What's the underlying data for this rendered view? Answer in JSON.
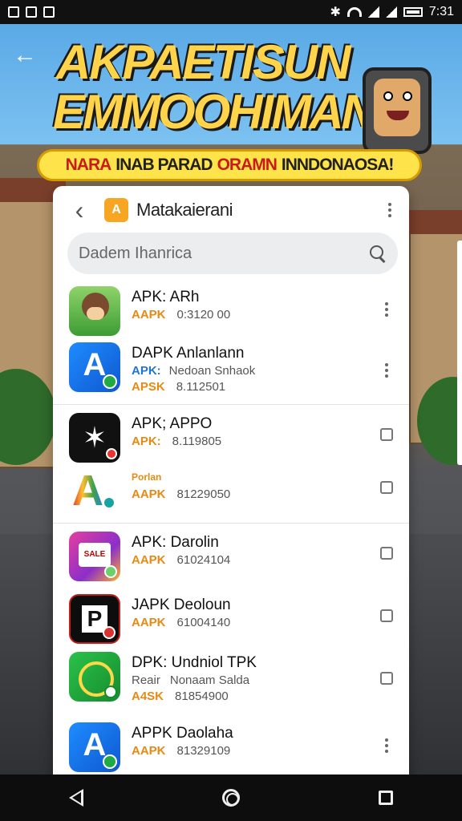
{
  "status_bar": {
    "time": "7:31"
  },
  "banner": {
    "title_line1": "AKPAETISUN",
    "title_line2": "EMMOOHIMANS",
    "ribbon_parts": [
      "NARA",
      "INAB PARAD",
      "ORAMN",
      "INNDONAOSA!"
    ]
  },
  "card": {
    "title": "Matakaierani",
    "badge": "A",
    "search_placeholder": "Dadem Ihanrica"
  },
  "items": [
    {
      "title": "APK: ARh",
      "line2_key": "AAPK",
      "line2_val": "0:3120 00",
      "icon": "monkey-icon",
      "action": "kebab"
    },
    {
      "title": "DAPK Anlanlann",
      "line2_key": "APK:",
      "line2_val": "Nedoan Snhaok",
      "line3_key": "APSK",
      "line3_val": "8.112501",
      "icon": "blue-a-icon",
      "action": "kebab"
    },
    {
      "title": "APK; APPO",
      "line2_key": "APK:",
      "line2_val": "8.119805",
      "icon": "black-spider-icon",
      "action": "checkbox"
    },
    {
      "title": "Porlan",
      "line2_key": "AAPK",
      "line2_val": "81229050",
      "icon": "color-a-icon",
      "action": "checkbox"
    },
    {
      "title": "APK: Darolin",
      "line2_key": "AAPK",
      "line2_val": "61024104",
      "icon": "pink-store-icon",
      "action": "checkbox"
    },
    {
      "title": "JAPK Deoloun",
      "line2_key": "AAPK",
      "line2_val": "61004140",
      "icon": "p-icon",
      "action": "checkbox"
    },
    {
      "title": "DPK: Undniol TPK",
      "line2_key": "Reair",
      "line2_val": "Nonaam Salda",
      "line3_key": "A4SK",
      "line3_val": "81854900",
      "icon": "green-chat-icon",
      "action": "checkbox"
    },
    {
      "title": "APPK Daolaha",
      "line2_key": "AAPK",
      "line2_val": "81329109",
      "icon": "blue-a-icon-2",
      "action": "kebab"
    }
  ],
  "colors": {
    "accent_orange": "#e88a12",
    "accent_blue": "#1f74d6",
    "banner_yellow": "#ffd34a"
  }
}
